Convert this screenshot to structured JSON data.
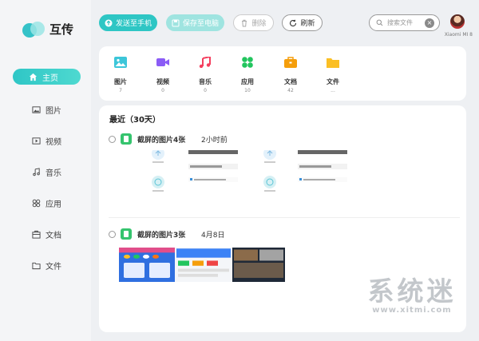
{
  "app": {
    "name": "互传"
  },
  "sidebar": {
    "items": [
      {
        "label": "主页",
        "icon": "home-icon",
        "active": true
      },
      {
        "label": "图片",
        "icon": "image-icon"
      },
      {
        "label": "视频",
        "icon": "video-icon"
      },
      {
        "label": "音乐",
        "icon": "music-icon"
      },
      {
        "label": "应用",
        "icon": "apps-icon"
      },
      {
        "label": "文档",
        "icon": "document-icon"
      },
      {
        "label": "文件",
        "icon": "folder-icon"
      }
    ]
  },
  "toolbar": {
    "send_label": "发送至手机",
    "save_label": "保存至电脑",
    "delete_label": "删除",
    "refresh_label": "刷新",
    "search_placeholder": "搜索文件",
    "device_name": "Xiaomi MI 8"
  },
  "categories": [
    {
      "label": "图片",
      "count": "7",
      "color": "#3cc6d9",
      "icon": "image-icon"
    },
    {
      "label": "视频",
      "count": "0",
      "color": "#8b5cf6",
      "icon": "video-icon"
    },
    {
      "label": "音乐",
      "count": "0",
      "color": "#f43f5e",
      "icon": "music-icon"
    },
    {
      "label": "应用",
      "count": "10",
      "color": "#22c55e",
      "icon": "apps-icon"
    },
    {
      "label": "文档",
      "count": "42",
      "color": "#f59e0b",
      "icon": "briefcase-icon"
    },
    {
      "label": "文件",
      "count": "...",
      "color": "#fbbf24",
      "icon": "folder-icon"
    }
  ],
  "recent": {
    "title": "最近（30天）",
    "groups": [
      {
        "name": "截屏的图片4张",
        "time": "2小时前"
      },
      {
        "name": "截屏的图片3张",
        "time": "4月8日"
      }
    ]
  },
  "watermark": {
    "big": "系统迷",
    "small": "www.xitmi.com"
  }
}
